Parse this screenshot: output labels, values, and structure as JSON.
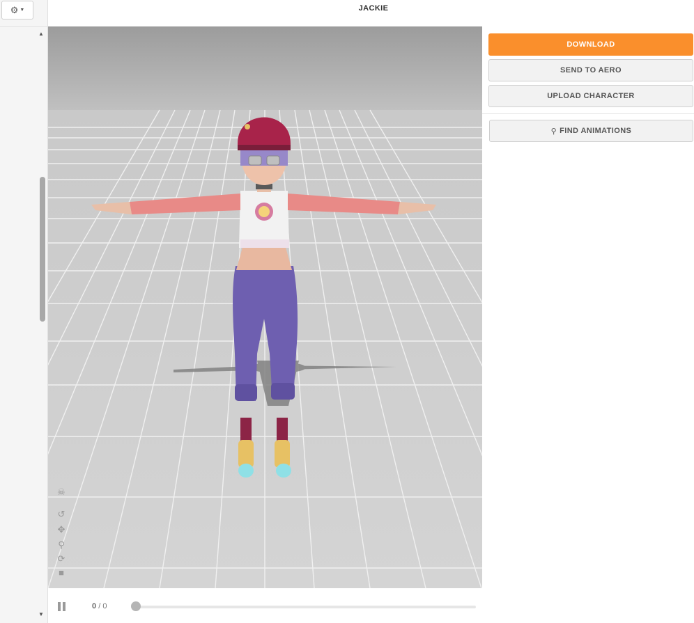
{
  "header": {
    "title": "JACKIE"
  },
  "sidebar": {
    "settings_icon": "gear-icon"
  },
  "actions": {
    "download_label": "DOWNLOAD",
    "send_aero_label": "SEND TO AERO",
    "upload_label": "UPLOAD CHARACTER",
    "find_animations_label": "FIND ANIMATIONS"
  },
  "playback": {
    "current_frame": "0",
    "separator": "/",
    "total_frames": "0",
    "progress": 0
  },
  "viewport_tools": [
    "skeleton-icon",
    "rotate-icon",
    "pan-icon",
    "zoom-icon",
    "orbit-icon",
    "camera-icon"
  ],
  "colors": {
    "accent": "#fa8f2c",
    "viewport_bg": "#c8c8c8",
    "helmet": "#a8234a",
    "sleeves": "#e88a87",
    "pants": "#6e5fb0"
  }
}
